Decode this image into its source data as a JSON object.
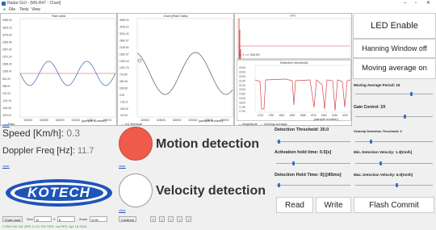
{
  "window": {
    "title": "Radar GUI - [MS-R47 - Chart]",
    "minimize": "–",
    "maximize": "▫",
    "close": "✕"
  },
  "menu": {
    "file": "File",
    "tools": "Tools",
    "view": "View"
  },
  "charts": {
    "raw": {
      "title": "Raw data",
      "y_ticks": [
        "4096.00",
        "3615.23",
        "3276.80",
        "2935.46",
        "2457.60",
        "1971.14",
        "1638.40",
        "1306.47",
        "819.20",
        "396.01",
        "120.00",
        "-341.15",
        "-640.36",
        "-819.20"
      ],
      "x_ticks": [
        "528051",
        "528055",
        "528209",
        "528213",
        "528217",
        "528221"
      ],
      "xlabel": "[sample number]",
      "legend": "Raw"
    },
    "zoom": {
      "title": "Zoom(Raw Data)",
      "y_ticks": [
        "4096.00",
        "3578.20",
        "3014.40",
        "2662.67",
        "2138.54",
        "1662.67",
        "1294.16",
        "1031.76",
        "719.80",
        "453.48",
        "183.86",
        "0.00",
        "-135.11",
        "-304.40",
        "-413.67"
      ],
      "x_ticks": [
        "528022",
        "528026",
        "528030",
        "528034",
        "528038",
        "528092"
      ],
      "xlabel": "[sample number]",
      "legend": "I/Q terminal"
    },
    "fft": {
      "title": "FFT",
      "y_ticks": [
        "66.40",
        "54.70",
        "45.00",
        "36.41",
        "28.28",
        "20.00",
        "14.62",
        "6.60",
        "0.00",
        "-10.50"
      ],
      "legend": "Magnitude",
      "legend_chart": "Moving average",
      "inset_label": "x: 1 => 334.90"
    },
    "detection": {
      "title": "Detection threshold",
      "y_ticks": [
        "23.00",
        "22.60",
        "22.00",
        "21.50",
        "20.40",
        "20.00",
        "19.60",
        "19.00",
        "18.00",
        "17.60",
        "17.00"
      ],
      "x_ticks": [
        "1744",
        "1780",
        "1816",
        "1852",
        "1888",
        "1924",
        "1960",
        "1996",
        "2032"
      ],
      "xlabel": "[sample number]"
    }
  },
  "left_controls": {
    "speed_label": "Speed [Km/h]:",
    "speed_value": "0.3",
    "doppler_label": "Doppler Freq [Hz]:",
    "doppler_value": "11.7",
    "motion_label": "Motion detection",
    "velocity_label": "Velocity detection",
    "logo_text": "KOTECH",
    "clear": "clear"
  },
  "right_buttons": {
    "led": "LED Enable",
    "hanning": "Hanning Window off",
    "moving_avg": "Moving average on",
    "read": "Read",
    "write": "Write",
    "flash": "Flash Commit"
  },
  "settings": {
    "moving_avg_period": "Moving Average Period:  15",
    "gain_control": "Gain Control:  2X",
    "detection_threshold": "Detection Threshold:  30.0",
    "velocity_threshold": "Velocity Detection Threshold:  4",
    "activation_hold": "Activation hold time:  0.5[s]",
    "min_velocity": "Min. Detection Velocity:  1.3[Km/h]",
    "detection_hold": "Detection Hold Time:  0[@85ms]",
    "max_velocity": "Max. Detection Velocity:  6.0[Km/h]"
  },
  "control_bar": {
    "chart_reset": "Chart reset",
    "grid_label": "Grid",
    "grid_value": "11",
    "x_label": "X",
    "x_value": "8",
    "zoom_label": "Zoom",
    "zoom_value": "2030",
    "continue": "Continue",
    "q1": "?",
    "q2": "?",
    "q3": "?",
    "q4": "?",
    "q5": "?"
  },
  "status": {
    "text": "COM9 OK   UB VER: 0.1.6, FW VER: n/a   REV: Apr 18 2018"
  },
  "colors": {
    "accent": "#3a6fc4",
    "red_led": "#ef5a4a",
    "logo_blue": "#1f55b8",
    "raw_line": "#3a5fb0",
    "threshold": "#d94545"
  }
}
